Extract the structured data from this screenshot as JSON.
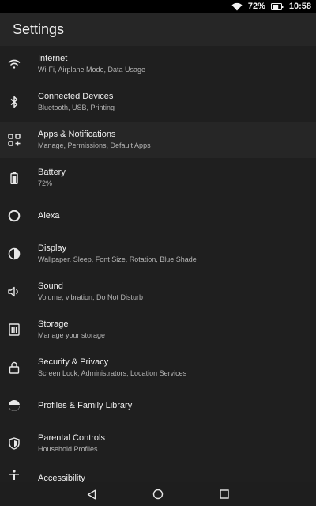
{
  "status_bar": {
    "battery_text": "72%",
    "time": "10:58",
    "battery_level": 0.72,
    "icons": [
      "wifi-icon",
      "battery-icon"
    ]
  },
  "header": {
    "title": "Settings"
  },
  "settings": [
    {
      "icon": "wifi-icon",
      "label": "Internet",
      "sub": "Wi-Fi, Airplane Mode, Data Usage"
    },
    {
      "icon": "bluetooth-icon",
      "label": "Connected Devices",
      "sub": "Bluetooth, USB, Printing"
    },
    {
      "icon": "apps-icon",
      "label": "Apps & Notifications",
      "sub": "Manage, Permissions, Default Apps"
    },
    {
      "icon": "battery-icon",
      "label": "Battery",
      "sub": "72%"
    },
    {
      "icon": "alexa-icon",
      "label": "Alexa",
      "sub": ""
    },
    {
      "icon": "display-icon",
      "label": "Display",
      "sub": "Wallpaper, Sleep, Font Size, Rotation, Blue Shade"
    },
    {
      "icon": "sound-icon",
      "label": "Sound",
      "sub": "Volume, vibration, Do Not Disturb"
    },
    {
      "icon": "storage-icon",
      "label": "Storage",
      "sub": "Manage your storage"
    },
    {
      "icon": "lock-icon",
      "label": "Security & Privacy",
      "sub": "Screen Lock, Administrators, Location Services"
    },
    {
      "icon": "profiles-icon",
      "label": "Profiles & Family Library",
      "sub": ""
    },
    {
      "icon": "shield-icon",
      "label": "Parental Controls",
      "sub": "Household Profiles"
    },
    {
      "icon": "accessibility-icon",
      "label": "Accessibility",
      "sub": ""
    }
  ],
  "nav_bar": {
    "icons": [
      "back-icon",
      "home-icon",
      "recents-icon"
    ]
  },
  "colors": {
    "background": "#1f1f1f",
    "highlight": "#262626",
    "text": "#f0f0f0",
    "subtext": "#b4b4b4"
  }
}
